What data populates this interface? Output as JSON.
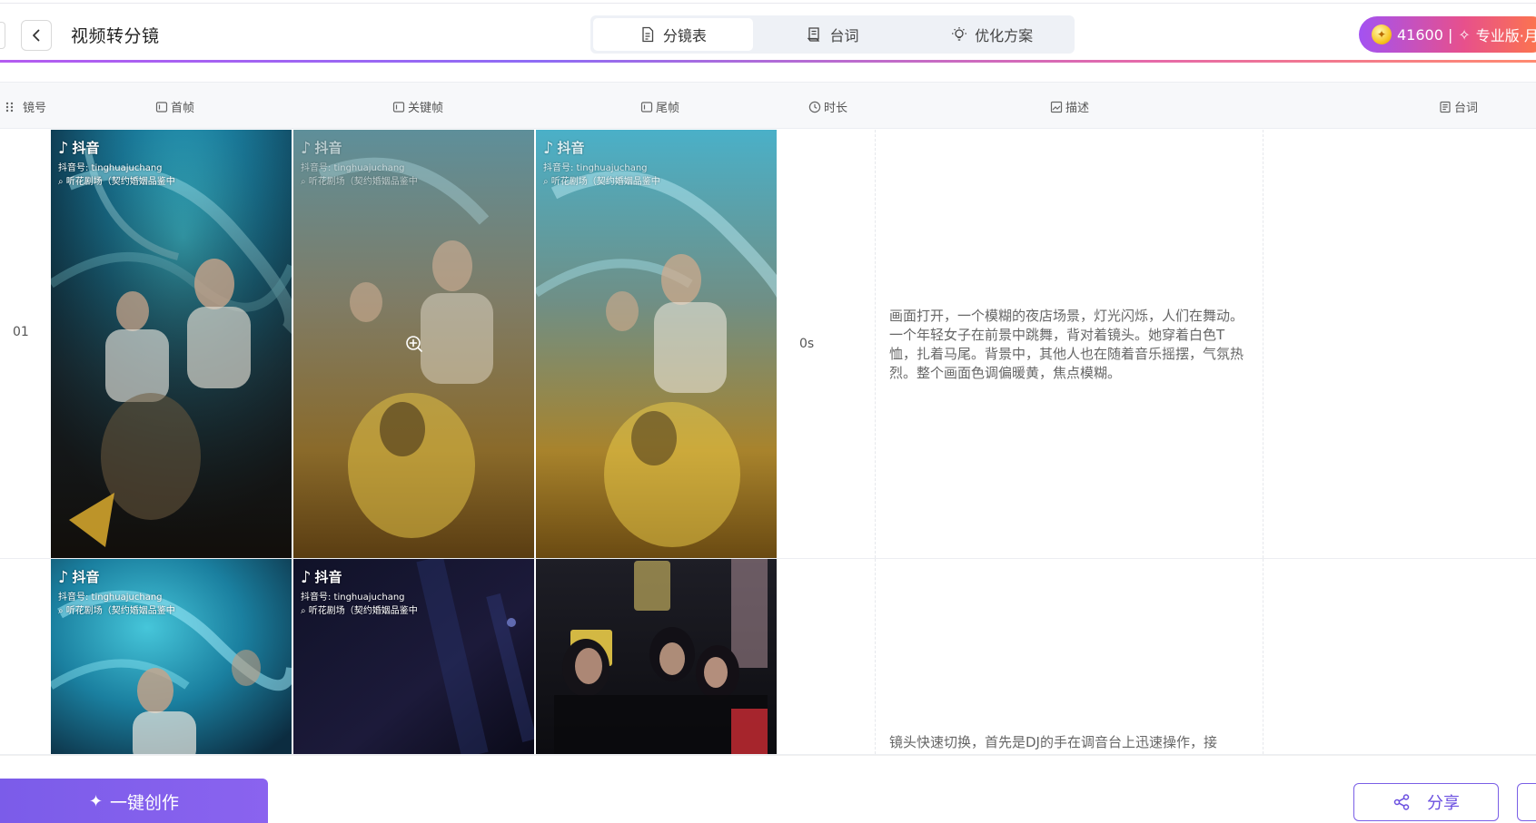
{
  "header": {
    "title": "视频转分镜",
    "tabs": [
      {
        "label": "分镜表",
        "icon": "document-icon",
        "active": true
      },
      {
        "label": "台词",
        "icon": "script-icon",
        "active": false
      },
      {
        "label": "优化方案",
        "icon": "lightbulb-icon",
        "active": false
      }
    ],
    "credits": "41600 |",
    "plan": "专业版·月"
  },
  "columns": {
    "shot_no": "镜号",
    "first_frame": "首帧",
    "key_frame": "关键帧",
    "last_frame": "尾帧",
    "duration": "时长",
    "description": "描述",
    "lines": "台词"
  },
  "watermark": {
    "brand": "抖音",
    "account": "抖音号: tinghuajuchang",
    "search": "听花剧场（契约婚姻品鉴中"
  },
  "rows": [
    {
      "shot_no": "01",
      "duration": "0s",
      "description": "画面打开，一个模糊的夜店场景，灯光闪烁，人们在舞动。一个年轻女子在前景中跳舞，背对着镜头。她穿着白色T恤，扎着马尾。背景中，其他人也在随着音乐摇摆，气氛热烈。整个画面色调偏暖黄，焦点模糊。"
    },
    {
      "shot_no": "",
      "duration": "",
      "description": "镜头快速切换，首先是DJ的手在调音台上迅速操作，接"
    }
  ],
  "footer": {
    "create_label": "一键创作",
    "share_label": "分享"
  },
  "colors": {
    "accent": "#7b5ce9",
    "credits_gradient_start": "#a352f2",
    "credits_gradient_end": "#ff7a45"
  }
}
